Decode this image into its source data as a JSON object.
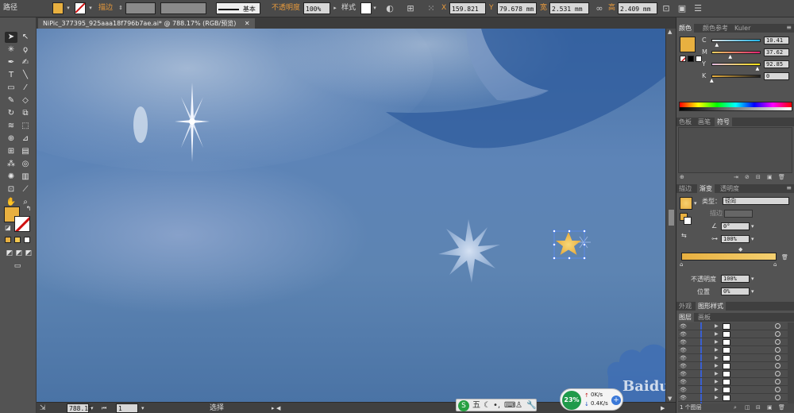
{
  "topbar": {
    "mode_label": "路径",
    "stroke_label": "描边",
    "stroke_style": "基本",
    "opacity_label": "不透明度",
    "opacity_value": "100%",
    "style_label": "样式",
    "x_label": "X",
    "x_value": "159.821",
    "y_label": "Y",
    "y_value": "79.678 mm",
    "w_label": "宽",
    "w_value": "2.531 mm",
    "h_label": "高",
    "h_value": "2.409 mm",
    "fill_color": "#e8b040"
  },
  "document": {
    "tab_title": "NiPic_377395_925aaa18f796b7ae.ai* @ 788.17% (RGB/预览)"
  },
  "status": {
    "zoom": "788.17",
    "page": "1",
    "tool": "选择"
  },
  "color_panel": {
    "tabs": [
      "颜色",
      "颜色参考",
      "Kuler"
    ],
    "channels": [
      {
        "label": "C",
        "value": "10.41",
        "colors": [
          "#e0e0e0",
          "#21b5e8"
        ]
      },
      {
        "label": "M",
        "value": "37.62",
        "colors": [
          "#e8d060",
          "#e02070"
        ]
      },
      {
        "label": "Y",
        "value": "92.85",
        "colors": [
          "#e0b8e0",
          "#f4e010"
        ]
      },
      {
        "label": "K",
        "value": "0",
        "colors": [
          "#e8b040",
          "#202020"
        ]
      }
    ]
  },
  "swatch_panel": {
    "tabs": [
      "色板",
      "画笔",
      "符号"
    ]
  },
  "gradient_panel": {
    "tabs": [
      "描边",
      "渐变",
      "透明度"
    ],
    "type_label": "类型：",
    "type_value": "径向",
    "edge_label": "描边",
    "angle_value": "0°",
    "aspect_value": "100%",
    "opacity_label": "不透明度",
    "opacity_value": "100%",
    "location_label": "位置",
    "location_value": "0%",
    "gradient_from": "#e8b040",
    "gradient_to": "#f4d070"
  },
  "appearance_panel": {
    "tabs": [
      "外观",
      "图形样式"
    ]
  },
  "layers_panel": {
    "tabs": [
      "图层",
      "画板"
    ],
    "footer": "1 个图层"
  },
  "taskbar": {
    "ime_char": "五",
    "cpu_percent": "23%",
    "upload": "0K/s",
    "download": "0.4K/s"
  },
  "watermark": "Baidu.com"
}
